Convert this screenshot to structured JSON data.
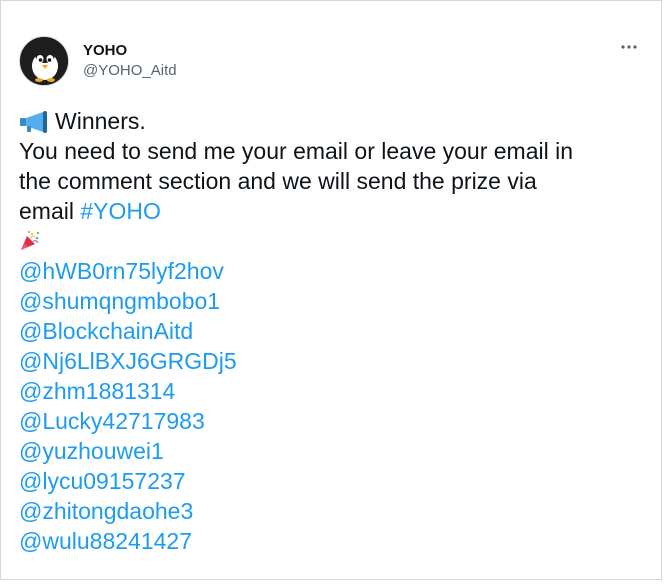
{
  "author": {
    "display_name": "YOHO",
    "handle": "@YOHO_Aitd",
    "avatar_icon": "penguin-avatar"
  },
  "menu": {
    "more_icon": "more-horizontal-icon"
  },
  "tweet": {
    "megaphone_icon": "megaphone-emoji",
    "heading": "Winners.",
    "line1": "You need to send me your email or leave your email in",
    "line2": "the comment section and we will send the prize via",
    "line3_text": "email ",
    "hashtag": "#YOHO",
    "party_icon": "party-popper-emoji",
    "mentions": [
      "@hWB0rn75lyf2hov",
      "@shumqngmbobo1",
      "@BlockchainAitd",
      "@Nj6LlBXJ6GRGDj5",
      "@zhm1881314",
      "@Lucky42717983",
      "@yuzhouwei1",
      "@lycu09157237",
      "@zhitongdaohe3",
      "@wulu88241427"
    ]
  },
  "colors": {
    "link": "#1d9bf0",
    "text": "#0f1419",
    "secondary": "#536471",
    "border": "#cfd9de"
  }
}
